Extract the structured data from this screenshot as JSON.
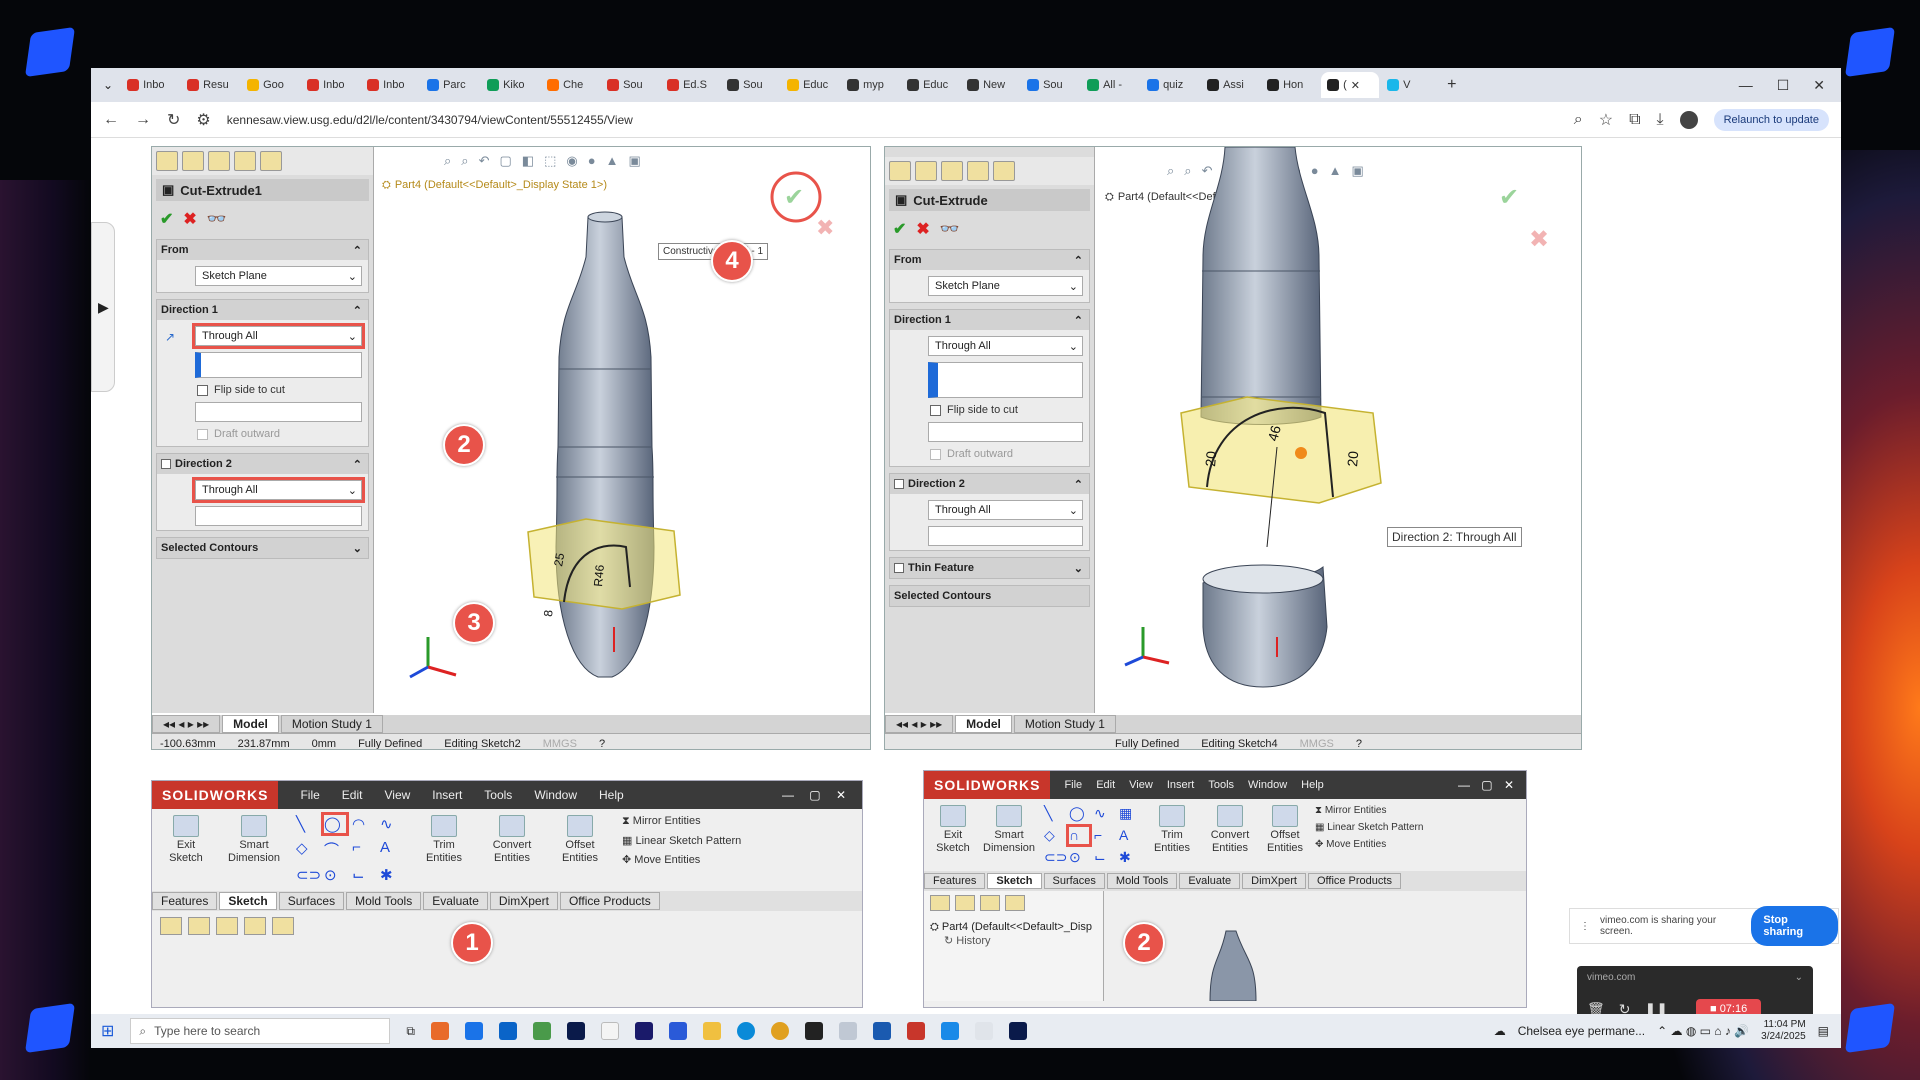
{
  "browser": {
    "tabs": [
      {
        "label": "Inbo",
        "color": "#d93025"
      },
      {
        "label": "Resu",
        "color": "#d93025"
      },
      {
        "label": "Goo",
        "color": "#f4b400"
      },
      {
        "label": "Inbo",
        "color": "#d93025"
      },
      {
        "label": "Inbo",
        "color": "#d93025"
      },
      {
        "label": "Parc",
        "color": "#1a73e8"
      },
      {
        "label": "Kiko",
        "color": "#0f9d58"
      },
      {
        "label": "Che",
        "color": "#ff6d00"
      },
      {
        "label": "Sou",
        "color": "#d93025"
      },
      {
        "label": "Ed.S",
        "color": "#d93025"
      },
      {
        "label": "Sou",
        "color": "#333333"
      },
      {
        "label": "Educ",
        "color": "#f4b400"
      },
      {
        "label": "myp",
        "color": "#333333"
      },
      {
        "label": "Educ",
        "color": "#333333"
      },
      {
        "label": "New",
        "color": "#333333"
      },
      {
        "label": "Sou",
        "color": "#1a73e8"
      },
      {
        "label": "All -",
        "color": "#0f9d58"
      },
      {
        "label": "quiz",
        "color": "#1a73e8"
      },
      {
        "label": "Assi",
        "color": "#222222"
      },
      {
        "label": "Hon",
        "color": "#222222"
      },
      {
        "label": "(",
        "color": "#222222",
        "active": true
      },
      {
        "label": "V",
        "color": "#1ab7ea"
      }
    ],
    "new_tab": "+",
    "url": "kennesaw.view.usg.edu/d2l/le/content/3430794/viewContent/55512455/View",
    "relaunch": "Relaunch to update"
  },
  "left_sw": {
    "feature_title": "Cut-Extrude1",
    "from_label": "From",
    "from_value": "Sketch Plane",
    "dir1_label": "Direction 1",
    "dir1_value": "Through All",
    "flip_label": "Flip side to cut",
    "draft_label": "Draft outward",
    "dir2_label": "Direction 2",
    "dir2_value": "Through All",
    "selected_contours": "Selected Contours",
    "tree": "Part4 (Default<<Default>_Display State 1>)",
    "tooltip": "Constructive Model - 1",
    "tabs": [
      "Model",
      "Motion Study 1"
    ],
    "status": [
      "-100.63mm",
      "231.87mm",
      "0mm",
      "Fully Defined",
      "Editing Sketch2",
      "MMGS"
    ],
    "dims": [
      "25",
      "R46",
      "8"
    ]
  },
  "right_sw": {
    "feature_title": "Cut-Extrude",
    "from_label": "From",
    "from_value": "Sketch Plane",
    "dir1_label": "Direction 1",
    "dir1_value": "Through All",
    "flip_label": "Flip side to cut",
    "draft_label": "Draft outward",
    "dir2_label": "Direction 2",
    "dir2_value": "Through All",
    "thin_label": "Thin Feature",
    "selected_contours": "Selected Contours",
    "tree": "Part4 (Default<<Default>_...",
    "tooltip": "Direction 2: Through All",
    "tabs": [
      "Model",
      "Motion Study 1"
    ],
    "status": [
      "Fully Defined",
      "Editing Sketch4",
      "MMGS"
    ],
    "dims": [
      "20",
      "46",
      "20"
    ]
  },
  "ribbon_left": {
    "logo": "SOLIDWORKS",
    "menus": [
      "File",
      "Edit",
      "View",
      "Insert",
      "Tools",
      "Window",
      "Help"
    ],
    "tools": [
      "Exit Sketch",
      "Smart Dimension",
      "Trim Entities",
      "Convert Entities",
      "Offset Entities"
    ],
    "list": [
      "Mirror Entities",
      "Linear Sketch Pattern",
      "Move Entities"
    ],
    "tabs": [
      "Features",
      "Sketch",
      "Surfaces",
      "Mold Tools",
      "Evaluate",
      "DimXpert",
      "Office Products"
    ]
  },
  "ribbon_right": {
    "logo": "SOLIDWORKS",
    "menus": [
      "File",
      "Edit",
      "View",
      "Insert",
      "Tools",
      "Window",
      "Help"
    ],
    "tools": [
      "Exit Sketch",
      "Smart Dimension",
      "Trim Entities",
      "Convert Entities",
      "Offset Entities"
    ],
    "list": [
      "Mirror Entities",
      "Linear Sketch Pattern",
      "Move Entities"
    ],
    "tabs": [
      "Features",
      "Sketch",
      "Surfaces",
      "Mold Tools",
      "Evaluate",
      "DimXpert",
      "Office Products"
    ],
    "tree": "Part4 (Default<<Default>_Disp",
    "history": "History"
  },
  "badges": {
    "b1": "1",
    "b2": "2",
    "b3": "3",
    "b4": "4",
    "b2r": "2"
  },
  "share": {
    "text": "vimeo.com is sharing your screen.",
    "button": "Stop sharing"
  },
  "vimeo": {
    "site": "vimeo.com",
    "timer": "07:16"
  },
  "taskbar": {
    "search": "Type here to search",
    "weather": "Chelsea eye permane...",
    "time": "11:04 PM",
    "date": "3/24/2025"
  },
  "colors": {
    "accent": "#e8534a",
    "brand": "#c8362b",
    "highlight": "#f2e57a"
  }
}
